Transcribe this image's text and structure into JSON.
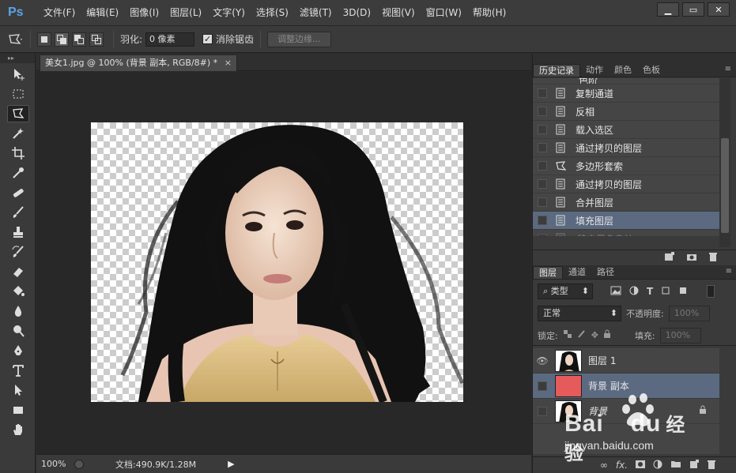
{
  "app": {
    "logo": "Ps"
  },
  "menu": [
    "文件(F)",
    "编辑(E)",
    "图像(I)",
    "图层(L)",
    "文字(Y)",
    "选择(S)",
    "滤镜(T)",
    "3D(D)",
    "视图(V)",
    "窗口(W)",
    "帮助(H)"
  ],
  "window_buttons": [
    "▁",
    "▭",
    "✕"
  ],
  "options_bar": {
    "feather_label": "羽化:",
    "feather_value": "0 像素",
    "antialias_label": "消除锯齿",
    "antialias_checked": true,
    "refine_edge_label": "调整边缘..."
  },
  "document": {
    "tab_title": "美女1.jpg @ 100% (背景 副本, RGB/8#) *",
    "close": "×"
  },
  "status": {
    "zoom": "100%",
    "doc_info": "文档:490.9K/1.28M"
  },
  "history_panel": {
    "tabs": [
      "历史记录",
      "动作",
      "颜色",
      "色板"
    ],
    "active_tab": 0,
    "partial_item": "色阶",
    "items": [
      {
        "label": "复制通道",
        "icon": "document-icon"
      },
      {
        "label": "反相",
        "icon": "document-icon"
      },
      {
        "label": "载入选区",
        "icon": "document-icon"
      },
      {
        "label": "通过拷贝的图层",
        "icon": "document-icon"
      },
      {
        "label": "多边形套索",
        "icon": "polygon-lasso-icon"
      },
      {
        "label": "通过拷贝的图层",
        "icon": "document-icon"
      },
      {
        "label": "合并图层",
        "icon": "document-icon"
      },
      {
        "label": "填充图层",
        "icon": "document-icon",
        "selected": true
      },
      {
        "label": "移去黑色杂边",
        "icon": "document-icon",
        "dimmed": true
      }
    ]
  },
  "layers_panel": {
    "tabs": [
      "图层",
      "通道",
      "路径"
    ],
    "active_tab": 0,
    "kind_filter": "类型",
    "blend_mode": "正常",
    "opacity_label": "不透明度:",
    "opacity_value": "100%",
    "lock_label": "锁定:",
    "fill_label": "填充:",
    "fill_value": "100%",
    "layers": [
      {
        "name": "图层 1",
        "visible": true,
        "thumb": "photo"
      },
      {
        "name": "背景 副本",
        "visible": false,
        "thumb": "red",
        "selected": true
      },
      {
        "name": "背景",
        "visible": false,
        "thumb": "photo",
        "locked": true,
        "italic": true
      }
    ]
  },
  "colors": {
    "accent_blue": "#5aa3e6",
    "selection": "#5b6a80",
    "layer_fill_red": "#e55a5a"
  },
  "watermark": {
    "brand": "Bai",
    "brand2": "du",
    "suffix": "经验",
    "url": "jingyan.baidu.com"
  }
}
